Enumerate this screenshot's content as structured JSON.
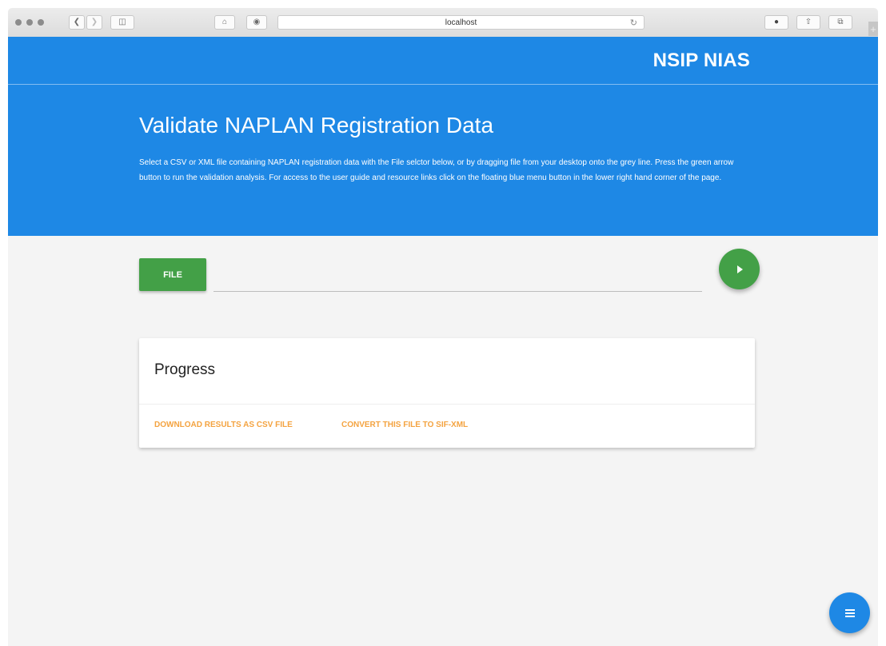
{
  "browser": {
    "url": "localhost",
    "icons": {
      "back": "chevron-left-icon",
      "forward": "chevron-right-icon",
      "sidebar": "sidebar-icon",
      "home": "home-icon",
      "extension": "shield-icon",
      "reload": "reload-icon",
      "info": "info-icon",
      "share": "share-icon",
      "tabs": "tabs-icon"
    }
  },
  "header": {
    "brand": "NSIP NIAS"
  },
  "hero": {
    "title": "Validate NAPLAN Registration Data",
    "description": "Select a CSV or XML file containing NAPLAN registration data with the File selctor below, or by dragging file from your desktop onto the grey line. Press the green arrow button to run the validation analysis. For access to the user guide and resource links click on the floating blue menu button in the lower right hand corner of the page."
  },
  "file_input": {
    "button_label": "FILE",
    "value": ""
  },
  "run_button": {
    "icon": "play-icon"
  },
  "progress_card": {
    "title": "Progress",
    "links": [
      "DOWNLOAD RESULTS AS CSV FILE",
      "CONVERT THIS FILE TO SIF-XML"
    ]
  },
  "menu_button": {
    "icon": "menu-icon"
  },
  "colors": {
    "primary": "#1e88e5",
    "success": "#43a047",
    "accent_link": "#f4a340",
    "background": "#f4f4f4"
  }
}
